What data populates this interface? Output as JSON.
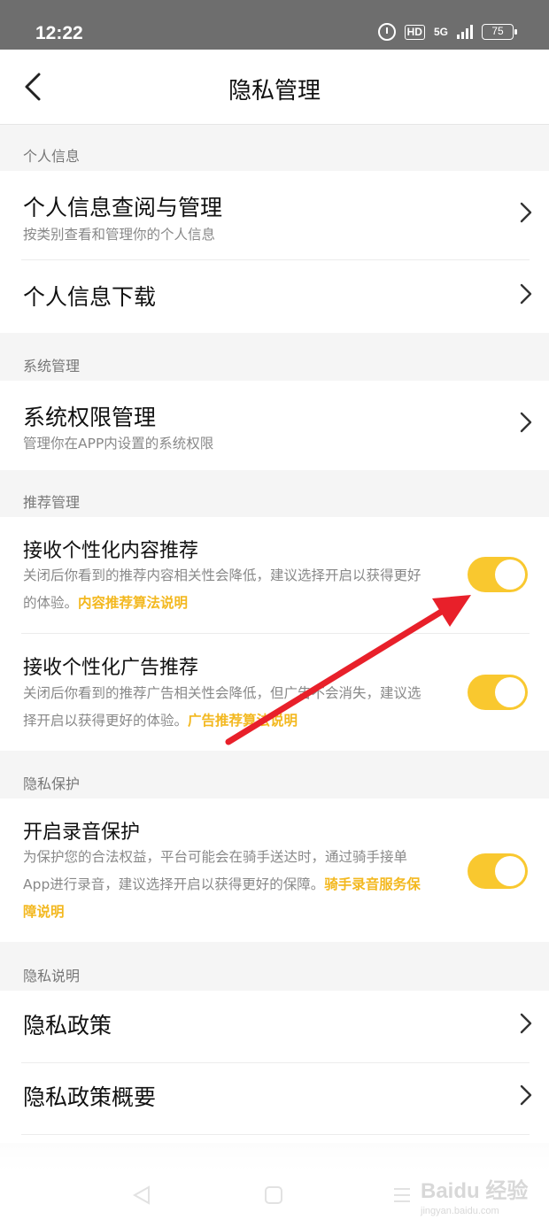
{
  "status_bar": {
    "time": "12:22",
    "hd": "HD",
    "network": "5G",
    "battery": "75"
  },
  "header": {
    "title": "隐私管理"
  },
  "sections": {
    "personal": {
      "label": "个人信息",
      "items": [
        {
          "title": "个人信息查阅与管理",
          "subtitle": "按类别查看和管理你的个人信息"
        },
        {
          "title": "个人信息下载"
        }
      ]
    },
    "system": {
      "label": "系统管理",
      "items": [
        {
          "title": "系统权限管理",
          "subtitle": "管理你在APP内设置的系统权限"
        }
      ]
    },
    "recommend": {
      "label": "推荐管理",
      "items": [
        {
          "title": "接收个性化内容推荐",
          "desc": "关闭后你看到的推荐内容相关性会降低，建议选择开启以获得更好的体验。",
          "link": "内容推荐算法说明",
          "toggle_on": true
        },
        {
          "title": "接收个性化广告推荐",
          "desc": "关闭后你看到的推荐广告相关性会降低，但广告不会消失，建议选择开启以获得更好的体验。",
          "link": "广告推荐算法说明",
          "toggle_on": true
        }
      ]
    },
    "protection": {
      "label": "隐私保护",
      "items": [
        {
          "title": "开启录音保护",
          "desc": "为保护您的合法权益，平台可能会在骑手送达时，通过骑手接单App进行录音，建议选择开启以获得更好的保障。",
          "link": "骑手录音服务保障说明",
          "toggle_on": true
        }
      ]
    },
    "policy": {
      "label": "隐私说明",
      "items": [
        {
          "title": "隐私政策"
        },
        {
          "title": "隐私政策概要"
        }
      ]
    }
  },
  "watermark": {
    "main": "Baidu 经验",
    "sub": "jingyan.baidu.com"
  },
  "colors": {
    "accent": "#f9c82f",
    "link": "#f3b81f",
    "arrow": "#e8202a"
  }
}
